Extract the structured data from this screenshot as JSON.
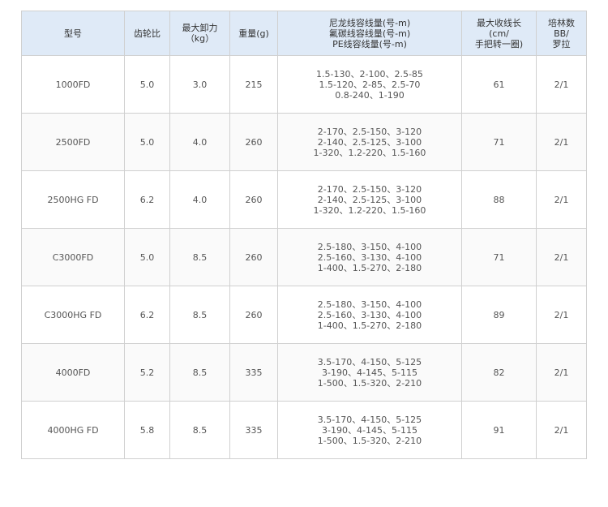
{
  "headers": {
    "model": "型号",
    "gear_ratio": "齿轮比",
    "max_drag_lines": [
      "最大卸力",
      "（kg）"
    ],
    "weight": "重量(g)",
    "line_capacity_lines": [
      "尼龙线容线量(号-m)",
      "氟碳线容线量(号-m)",
      "PE线容线量(号-m)"
    ],
    "retrieve_lines": [
      "最大收线长",
      "(cm/",
      "手把转一圈)"
    ],
    "bearings_lines": [
      "培林数",
      "BB/",
      "罗拉"
    ]
  },
  "rows": [
    {
      "model": "1000FD",
      "gear_ratio": "5.0",
      "max_drag": "3.0",
      "weight": "215",
      "capacity": [
        "1.5-130、2-100、2.5-85",
        "1.5-120、2-85、2.5-70",
        "0.8-240、1-190"
      ],
      "retrieve": "61",
      "bearings": "2/1"
    },
    {
      "model": "2500FD",
      "gear_ratio": "5.0",
      "max_drag": "4.0",
      "weight": "260",
      "capacity": [
        "2-170、2.5-150、3-120",
        "2-140、2.5-125、3-100",
        "1-320、1.2-220、1.5-160"
      ],
      "retrieve": "71",
      "bearings": "2/1"
    },
    {
      "model": "2500HG FD",
      "gear_ratio": "6.2",
      "max_drag": "4.0",
      "weight": "260",
      "capacity": [
        "2-170、2.5-150、3-120",
        "2-140、2.5-125、3-100",
        "1-320、1.2-220、1.5-160"
      ],
      "retrieve": "88",
      "bearings": "2/1"
    },
    {
      "model": "C3000FD",
      "gear_ratio": "5.0",
      "max_drag": "8.5",
      "weight": "260",
      "capacity": [
        "2.5-180、3-150、4-100",
        "2.5-160、3-130、4-100",
        "1-400、1.5-270、2-180"
      ],
      "retrieve": "71",
      "bearings": "2/1"
    },
    {
      "model": "C3000HG FD",
      "gear_ratio": "6.2",
      "max_drag": "8.5",
      "weight": "260",
      "capacity": [
        "2.5-180、3-150、4-100",
        "2.5-160、3-130、4-100",
        "1-400、1.5-270、2-180"
      ],
      "retrieve": "89",
      "bearings": "2/1"
    },
    {
      "model": "4000FD",
      "gear_ratio": "5.2",
      "max_drag": "8.5",
      "weight": "335",
      "capacity": [
        "3.5-170、4-150、5-125",
        "3-190、4-145、5-115",
        "1-500、1.5-320、2-210"
      ],
      "retrieve": "82",
      "bearings": "2/1"
    },
    {
      "model": "4000HG FD",
      "gear_ratio": "5.8",
      "max_drag": "8.5",
      "weight": "335",
      "capacity": [
        "3.5-170、4-150、5-125",
        "3-190、4-145、5-115",
        "1-500、1.5-320、2-210"
      ],
      "retrieve": "91",
      "bearings": "2/1"
    }
  ]
}
